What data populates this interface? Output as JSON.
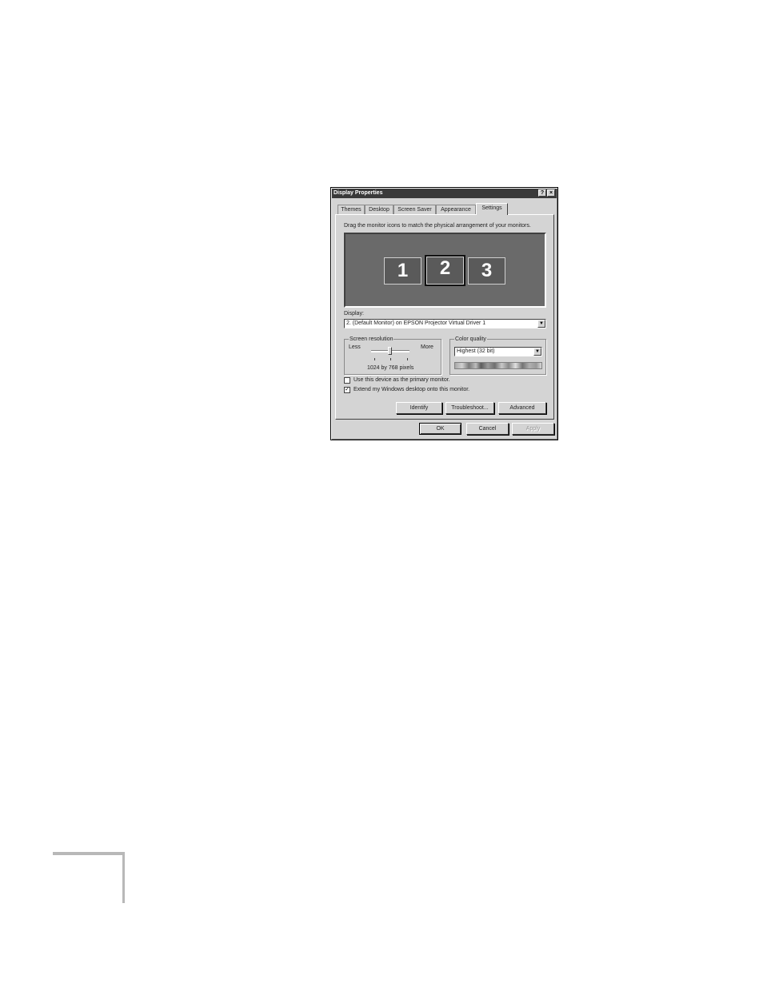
{
  "dialog": {
    "title": "Display Properties",
    "help_glyph": "?",
    "close_glyph": "×"
  },
  "tabs": [
    {
      "label": "Themes"
    },
    {
      "label": "Desktop"
    },
    {
      "label": "Screen Saver"
    },
    {
      "label": "Appearance"
    },
    {
      "label": "Settings",
      "active": true
    }
  ],
  "settings": {
    "instruction": "Drag the monitor icons to match the physical arrangement of your monitors.",
    "monitors": [
      {
        "label": "1"
      },
      {
        "label": "2",
        "selected": true
      },
      {
        "label": "3"
      }
    ],
    "display_label": "Display:",
    "display_value": "2. (Default Monitor) on EPSON Projector Virtual Driver 1",
    "screen_resolution": {
      "label": "Screen resolution",
      "less": "Less",
      "more": "More",
      "value_text": "1024 by 768 pixels"
    },
    "color_quality": {
      "label": "Color quality",
      "value": "Highest (32 bit)"
    },
    "primary_checkbox": {
      "label": "Use this device as the primary monitor.",
      "checked": false
    },
    "extend_checkbox": {
      "label": "Extend my Windows desktop onto this monitor.",
      "checked": true,
      "check_glyph": "✓"
    },
    "buttons": {
      "identify": "Identify",
      "troubleshoot": "Troubleshoot...",
      "advanced": "Advanced"
    }
  },
  "footer": {
    "ok": "OK",
    "cancel": "Cancel",
    "apply": "Apply"
  },
  "dropdown_glyph": "▼"
}
